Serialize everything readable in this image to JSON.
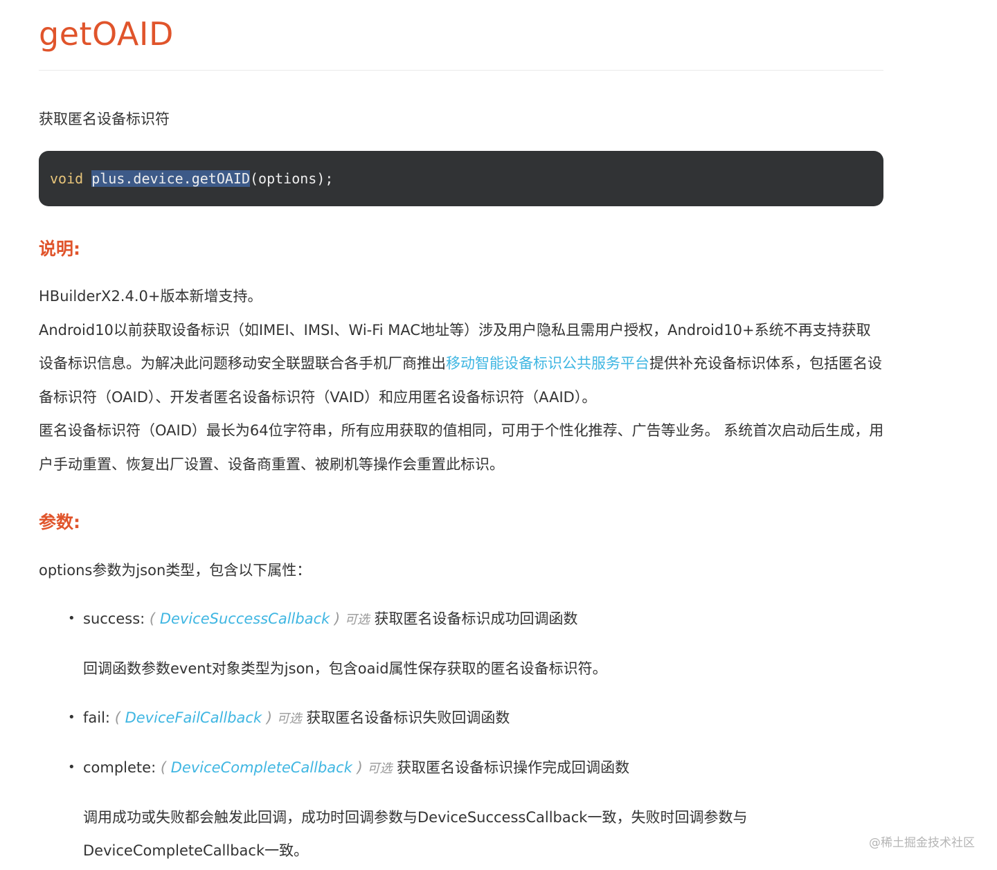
{
  "title": "getOAID",
  "summary": "获取匿名设备标识符",
  "code": {
    "keyword": "void",
    "selected": "plus.device.getOAID",
    "rest": "(options);"
  },
  "sections": {
    "description_heading": "说明:",
    "params_heading": "参数:"
  },
  "description": {
    "line1": "HBuilderX2.4.0+版本新增支持。",
    "para2_before_link": "Android10以前获取设备标识（如IMEI、IMSI、Wi-Fi MAC地址等）涉及用户隐私且需用户授权，Android10+系统不再支持获取设备标识信息。为解决此问题移动安全联盟联合各手机厂商推出",
    "para2_link": "移动智能设备标识公共服务平台",
    "para2_after_link": "提供补充设备标识体系，包括匿名设备标识符（OAID）、开发者匿名设备标识符（VAID）和应用匿名设备标识符（AAID）。",
    "para3": "匿名设备标识符（OAID）最长为64位字符串，所有应用获取的值相同，可用于个性化推荐、广告等业务。 系统首次启动后生成，用户手动重置、恢复出厂设置、设备商重置、被刷机等操作会重置此标识。"
  },
  "options_intro": "options参数为json类型，包含以下属性：",
  "params": [
    {
      "name": "success:",
      "type": "DeviceSuccessCallback",
      "optional": "可选",
      "desc": "获取匿名设备标识成功回调函数",
      "note": "回调函数参数event对象类型为json，包含oaid属性保存获取的匿名设备标识符。"
    },
    {
      "name": "fail:",
      "type": "DeviceFailCallback",
      "optional": "可选",
      "desc": "获取匿名设备标识失败回调函数"
    },
    {
      "name": "complete:",
      "type": "DeviceCompleteCallback",
      "optional": "可选",
      "desc": "获取匿名设备标识操作完成回调函数",
      "note": "调用成功或失败都会触发此回调，成功时回调参数与DeviceSuccessCallback一致，失败时回调参数与DeviceCompleteCallback一致。"
    }
  ],
  "paren_open": "(",
  "paren_close": ")",
  "bullet": "•",
  "watermark": "@稀土掘金技术社区"
}
